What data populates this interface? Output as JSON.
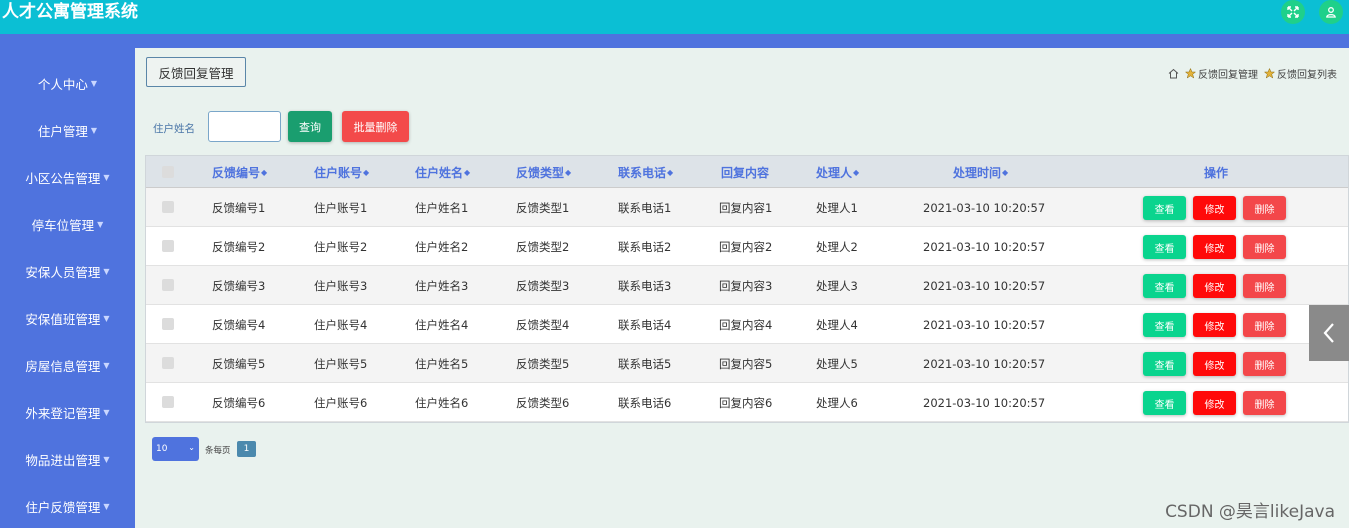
{
  "app": {
    "title": "人才公寓管理系统"
  },
  "header": {
    "icons": [
      "expand-icon",
      "user-icon"
    ]
  },
  "sidebar": {
    "items": [
      {
        "label": "个人中心"
      },
      {
        "label": "住户管理"
      },
      {
        "label": "小区公告管理"
      },
      {
        "label": "停车位管理"
      },
      {
        "label": "安保人员管理"
      },
      {
        "label": "安保值班管理"
      },
      {
        "label": "房屋信息管理"
      },
      {
        "label": "外来登记管理"
      },
      {
        "label": "物品进出管理"
      },
      {
        "label": "住户反馈管理"
      }
    ]
  },
  "page": {
    "tag": "反馈回复管理",
    "breadcrumb": [
      "反馈回复管理",
      "反馈回复列表"
    ]
  },
  "search": {
    "label": "住户姓名",
    "value": "",
    "query_button": "查询",
    "bulk_delete_button": "批量删除"
  },
  "table": {
    "headers": [
      "反馈编号",
      "住户账号",
      "住户姓名",
      "反馈类型",
      "联系电话",
      "回复内容",
      "处理人",
      "处理时间",
      "操作"
    ],
    "rows": [
      [
        "反馈编号1",
        "住户账号1",
        "住户姓名1",
        "反馈类型1",
        "联系电话1",
        "回复内容1",
        "处理人1",
        "2021-03-10 10:20:57"
      ],
      [
        "反馈编号2",
        "住户账号2",
        "住户姓名2",
        "反馈类型2",
        "联系电话2",
        "回复内容2",
        "处理人2",
        "2021-03-10 10:20:57"
      ],
      [
        "反馈编号3",
        "住户账号3",
        "住户姓名3",
        "反馈类型3",
        "联系电话3",
        "回复内容3",
        "处理人3",
        "2021-03-10 10:20:57"
      ],
      [
        "反馈编号4",
        "住户账号4",
        "住户姓名4",
        "反馈类型4",
        "联系电话4",
        "回复内容4",
        "处理人4",
        "2021-03-10 10:20:57"
      ],
      [
        "反馈编号5",
        "住户账号5",
        "住户姓名5",
        "反馈类型5",
        "联系电话5",
        "回复内容5",
        "处理人5",
        "2021-03-10 10:20:57"
      ],
      [
        "反馈编号6",
        "住户账号6",
        "住户姓名6",
        "反馈类型6",
        "联系电话6",
        "回复内容6",
        "处理人6",
        "2021-03-10 10:20:57"
      ]
    ],
    "actions": {
      "view": "查看",
      "edit": "修改",
      "delete": "删除"
    }
  },
  "pager": {
    "page_size": "10",
    "per_page_label": "条每页",
    "current_page": "1"
  },
  "watermark": "CSDN @昊言likeJava",
  "colors": {
    "header": "#0bbfd4",
    "sidebar": "#4f73de",
    "view": "#0ad48e",
    "edit": "#ff0a0a",
    "delete": "#f3474a"
  }
}
